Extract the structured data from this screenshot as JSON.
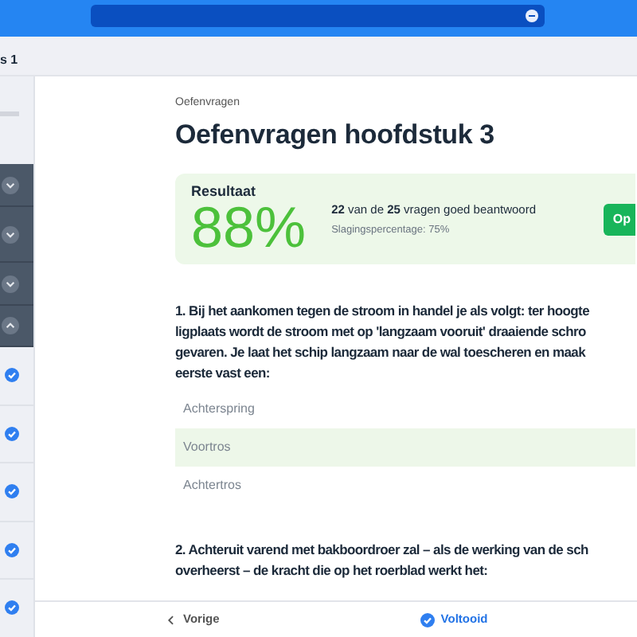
{
  "course_header": {
    "title": "s 1"
  },
  "sidebar": {
    "items": [
      {
        "kind": "section",
        "expanded": false
      },
      {
        "kind": "section",
        "expanded": false
      },
      {
        "kind": "section",
        "expanded": false
      },
      {
        "kind": "section",
        "expanded": true
      },
      {
        "kind": "lesson",
        "completed": true
      },
      {
        "kind": "lesson",
        "completed": true
      },
      {
        "kind": "lesson",
        "completed": true
      },
      {
        "kind": "lesson",
        "completed": true
      },
      {
        "kind": "lesson",
        "completed": true
      }
    ]
  },
  "page": {
    "eyebrow": "Oefenvragen",
    "title": "Oefenvragen hoofdstuk 3"
  },
  "result": {
    "label": "Resultaat",
    "score": "88%",
    "summary": "**22** van de **25** vragen goed beantwoord",
    "pass_rate": "Slagingspercentage: 75%",
    "button": "Op"
  },
  "questions": [
    {
      "lines": [
        "1. Bij het aankomen tegen de stroom in handel je als volgt: ter hoogte",
        "ligplaats wordt de stroom met op 'langzaam vooruit' draaiende schro",
        "gevaren. Je laat het schip langzaam naar de wal toescheren en maak",
        "eerste vast een:"
      ],
      "options": [
        {
          "text": "Achterspring",
          "selected": false
        },
        {
          "text": "Voortros",
          "selected": true
        },
        {
          "text": "Achtertros",
          "selected": false
        }
      ]
    },
    {
      "lines": [
        "2. Achteruit varend met bakboordroer zal – als de werking van de sch",
        "overheerst – de kracht die op het roerblad werkt het:"
      ]
    }
  ],
  "footer": {
    "previous": "Vorige",
    "complete": "Voltooid",
    "completed": true
  }
}
